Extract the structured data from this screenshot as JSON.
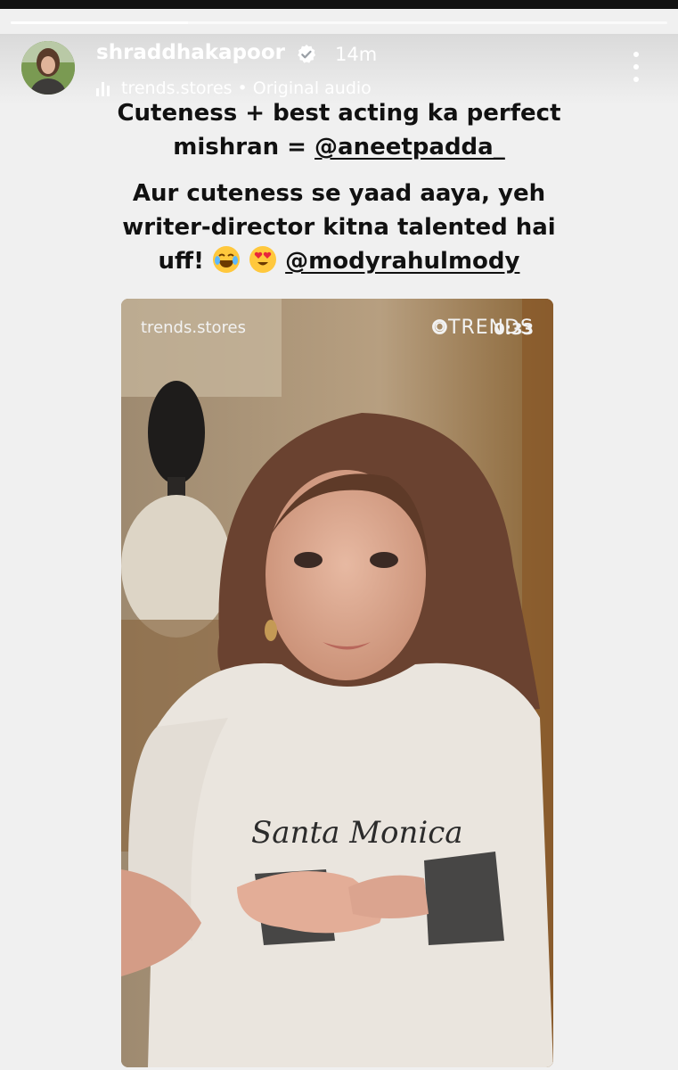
{
  "story": {
    "progress_fraction": 0.27,
    "segments": 2
  },
  "header": {
    "username": "shraddhakapoor",
    "time": "14m",
    "audio_source": "trends.stores",
    "audio_separator": "•",
    "audio_label": "Original audio"
  },
  "caption": {
    "line1a": "Cuteness + best acting ka perfect",
    "line1b": "mishran = ",
    "mention1": "@aneetpadda_",
    "line2a": "Aur cuteness se yaad aaya, yeh",
    "line2b": "writer-director kitna talented hai",
    "line2c": "uff! ",
    "mention2": "@modyrahulmody"
  },
  "video": {
    "watermark": "trends.stores",
    "brand": "TRENDS",
    "timer": "0:33",
    "shirt_text": "Santa Monica"
  },
  "icons": {
    "verified": "verified-badge-icon",
    "audio": "audio-bars-icon",
    "more": "more-vertical-icon",
    "emoji1": "laughing-tears-emoji",
    "emoji2": "heart-eyes-emoji"
  }
}
